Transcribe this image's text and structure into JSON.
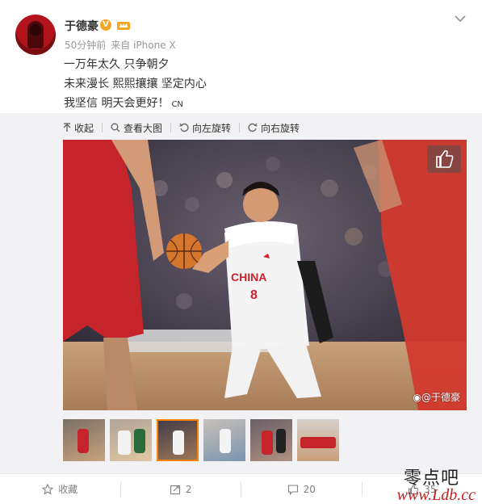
{
  "post": {
    "username": "于德豪",
    "verified_badge": "V",
    "meta_time": "50分钟前",
    "meta_source": "来自 iPhone X",
    "lines": [
      "一万年太久 只争朝夕",
      "未来漫长 熙熙攘攘 坚定内心",
      "我坚信 明天会更好！"
    ],
    "line_suffix": "CN"
  },
  "toolbar": {
    "collapse": "收起",
    "view_large": "查看大图",
    "rotate_left": "向左旋转",
    "rotate_right": "向右旋转"
  },
  "photo": {
    "watermark": "@于德豪",
    "jersey_text": "CHINA",
    "jersey_number": "8"
  },
  "thumbnails": {
    "count": 6,
    "active_index": 2
  },
  "footer": {
    "favorite": "收藏",
    "repost_count": "2",
    "comment_count": "20",
    "like_count": "35"
  },
  "site_watermark": {
    "cn": "零点吧",
    "url": "www.Ldb.cc"
  },
  "colors": {
    "accent": "#ff8200",
    "badge": "#f5a623",
    "jersey_red": "#d0202a"
  }
}
